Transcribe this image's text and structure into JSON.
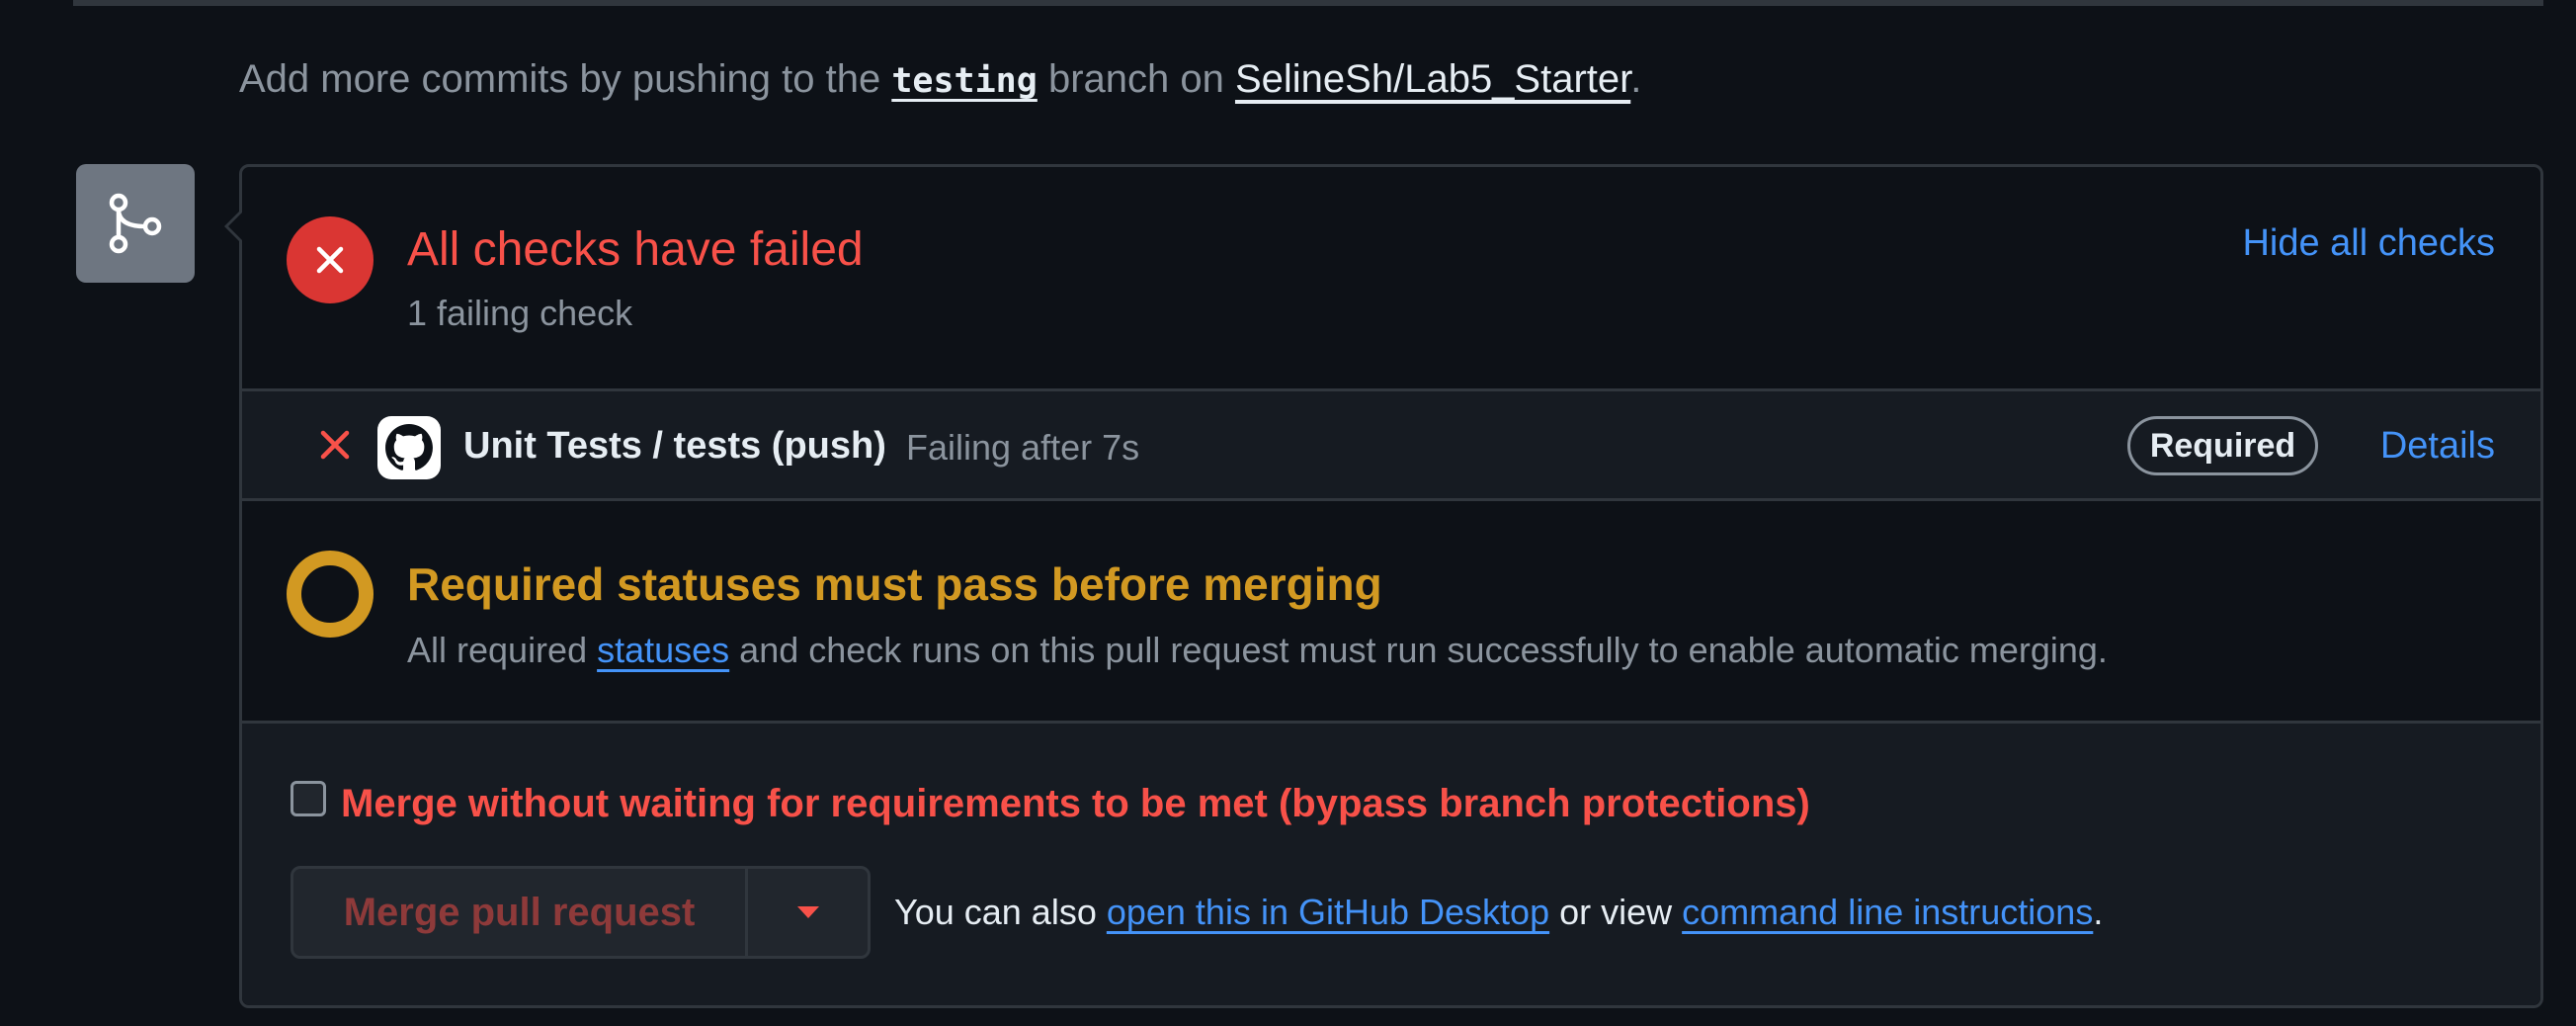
{
  "intro": {
    "prefix": "Add more commits by pushing to the ",
    "branch": "testing",
    "middle": " branch on ",
    "repo": "SelineSh/Lab5_Starter",
    "suffix": "."
  },
  "checks": {
    "title": "All checks have failed",
    "subtitle": "1 failing check",
    "hide_label": "Hide all checks",
    "rows": [
      {
        "name": "Unit Tests / tests (push)",
        "status": "Failing after 7s",
        "badge": "Required",
        "details": "Details"
      }
    ]
  },
  "required": {
    "title": "Required statuses must pass before merging",
    "desc_prefix": "All required ",
    "desc_link": "statuses",
    "desc_suffix": " and check runs on this pull request must run successfully to enable automatic merging."
  },
  "merge": {
    "bypass_label": "Merge without waiting for requirements to be met (bypass branch protections)",
    "button_label": "Merge pull request",
    "alt_prefix": "You can also ",
    "alt_link1": "open this in GitHub Desktop",
    "alt_middle": " or view ",
    "alt_link2": "command line instructions",
    "alt_suffix": "."
  },
  "colors": {
    "background": "#0d1117",
    "failure": "#f85149",
    "pending": "#d29922",
    "link": "#4493f8",
    "border": "#30363d"
  }
}
